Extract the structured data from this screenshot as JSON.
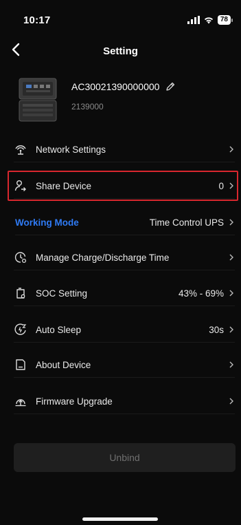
{
  "status_bar": {
    "time": "10:17",
    "battery": "78"
  },
  "header": {
    "title": "Setting"
  },
  "device": {
    "name": "AC30021390000000",
    "serial": "2139000"
  },
  "rows": [
    {
      "label": "Network Settings",
      "value": ""
    },
    {
      "label": "Share Device",
      "value": "0"
    },
    {
      "label": "Working Mode",
      "value": "Time Control UPS"
    },
    {
      "label": "Manage Charge/Discharge Time",
      "value": ""
    },
    {
      "label": "SOC Setting",
      "value": "43% - 69%"
    },
    {
      "label": "Auto Sleep",
      "value": "30s"
    },
    {
      "label": "About Device",
      "value": ""
    },
    {
      "label": "Firmware Upgrade",
      "value": ""
    }
  ],
  "unbind_label": "Unbind",
  "colors": {
    "accent": "#2f7bf5",
    "highlight": "#d9272e",
    "background": "#0b0b0b"
  },
  "icons": [
    "back-arrow-icon",
    "signal-icon",
    "wifi-icon",
    "battery-icon",
    "edit-pencil-icon",
    "network-icon",
    "share-user-icon",
    "clock-settings-icon",
    "soc-battery-icon",
    "sleep-icon",
    "about-device-icon",
    "firmware-upgrade-icon",
    "chevron-right-icon"
  ]
}
